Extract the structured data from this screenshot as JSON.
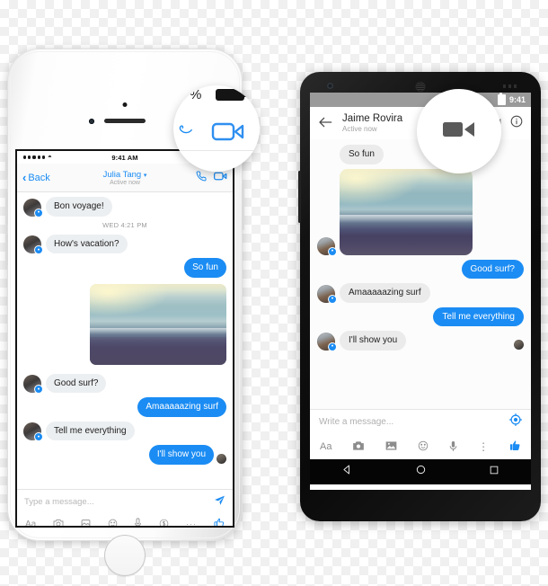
{
  "scene": {
    "title": "Facebook Messenger video call feature on iPhone and Android",
    "background": "checkerboard-transparency"
  },
  "colors": {
    "messenger_blue": "#1b8cf3",
    "incoming_bubble": "#eceff1",
    "android_status_bar": "#9a9a9a",
    "android_nav_bar": "#050505",
    "progress_blue": "#1565d8"
  },
  "iphone": {
    "device": "iPhone",
    "status_bar": {
      "carrier_dots": 5,
      "wifi_icon": "wifi-icon",
      "time": "9:41 AM",
      "battery_icon": "battery-icon"
    },
    "nav": {
      "back_label": "Back",
      "back_icon": "chevron-left-icon",
      "contact_name": "Julia Tang",
      "caret": "▾",
      "presence": "Active now",
      "phone_icon": "phone-icon",
      "video_icon": "video-camera-icon"
    },
    "messages": [
      {
        "id": 1,
        "dir": "in",
        "text": "Bon voyage!"
      },
      {
        "id": 2,
        "type": "timestamp",
        "text": "WED 4:21 PM"
      },
      {
        "id": 3,
        "dir": "in",
        "text": "How's vacation?"
      },
      {
        "id": 4,
        "dir": "out",
        "text": "So fun"
      },
      {
        "id": 5,
        "dir": "out",
        "type": "photo",
        "alt": "beach-photo"
      },
      {
        "id": 6,
        "dir": "in",
        "text": "Good surf?"
      },
      {
        "id": 7,
        "dir": "out",
        "text": "Amaaaaazing surf"
      },
      {
        "id": 8,
        "dir": "in",
        "text": "Tell me everything"
      },
      {
        "id": 9,
        "dir": "out",
        "text": "I'll show you"
      }
    ],
    "compose": {
      "placeholder": "Type a message...",
      "value": "",
      "send_icon": "send-paper-plane-icon"
    },
    "toolbar": [
      {
        "name": "text-format-icon",
        "glyph": "Aa"
      },
      {
        "name": "camera-icon",
        "glyph": "◎"
      },
      {
        "name": "photo-gallery-icon",
        "glyph": "❑"
      },
      {
        "name": "emoji-icon",
        "glyph": "☺"
      },
      {
        "name": "microphone-icon",
        "glyph": "☳"
      },
      {
        "name": "payment-dollar-icon",
        "glyph": "$"
      },
      {
        "name": "more-options-icon",
        "glyph": "···"
      },
      {
        "name": "thumbs-up-icon",
        "glyph": "👍"
      }
    ]
  },
  "android": {
    "device": "Android",
    "status_bar": {
      "time": "9:41",
      "battery_icon": "battery-icon"
    },
    "appbar": {
      "back_icon": "arrow-left-icon",
      "contact_name": "Jaime Rovira",
      "presence": "Active now",
      "video_icon": "video-camera-icon",
      "info_icon": "info-circle-icon"
    },
    "messages": [
      {
        "id": 1,
        "dir": "in",
        "text": "So fun"
      },
      {
        "id": 2,
        "dir": "in",
        "type": "photo",
        "alt": "beach-photo"
      },
      {
        "id": 3,
        "dir": "out",
        "text": "Good surf?"
      },
      {
        "id": 4,
        "dir": "in",
        "text": "Amaaaaazing surf"
      },
      {
        "id": 5,
        "dir": "out",
        "text": "Tell me everything"
      },
      {
        "id": 6,
        "dir": "in",
        "text": "I'll show you"
      }
    ],
    "compose": {
      "placeholder": "Write a message...",
      "value": "",
      "location_icon": "location-target-icon"
    },
    "toolbar": [
      {
        "name": "text-format-icon",
        "glyph": "Aa"
      },
      {
        "name": "camera-icon",
        "glyph": "◎"
      },
      {
        "name": "photo-gallery-icon",
        "glyph": "❑"
      },
      {
        "name": "emoji-icon",
        "glyph": "☺"
      },
      {
        "name": "microphone-icon",
        "glyph": "☳"
      },
      {
        "name": "overflow-menu-icon",
        "glyph": "⋮"
      },
      {
        "name": "thumbs-up-icon",
        "glyph": "👍"
      }
    ],
    "nav_bar": [
      {
        "name": "nav-back-icon",
        "glyph": "◁"
      },
      {
        "name": "nav-home-icon",
        "glyph": "○"
      },
      {
        "name": "nav-recents-icon",
        "glyph": "□"
      }
    ]
  },
  "magnifiers": {
    "ios": {
      "label": "ios-video-call-magnifier",
      "battery_percent_fragment": "%",
      "icon": "video-camera-icon-outline"
    },
    "android": {
      "label": "android-video-call-magnifier",
      "icon": "video-camera-icon-solid"
    }
  }
}
